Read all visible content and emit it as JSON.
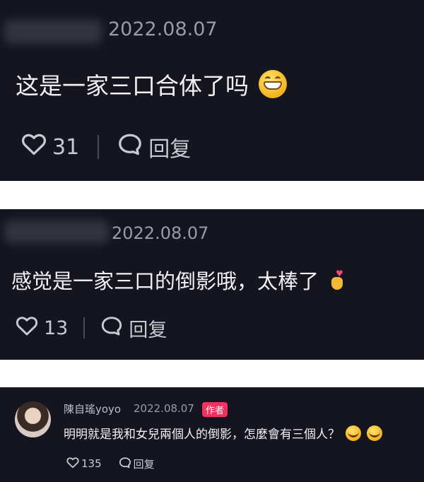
{
  "comments": [
    {
      "date": "2022.08.07",
      "text": "这是一家三口合体了吗",
      "emoji": "grinning-face-emoji",
      "likes": "31",
      "reply_label": "回复"
    },
    {
      "date": "2022.08.07",
      "text": "感觉是一家三口的倒影哦，太棒了",
      "emoji": "heart-hand-emoji",
      "likes": "13",
      "reply_label": "回复"
    },
    {
      "username": "陳自瑤yoyo",
      "date": "2022.08.07",
      "badge": "作者",
      "text": "明明就是我和女兒兩個人的倒影，怎麼會有三個人？",
      "emoji": "tears-of-joy-emoji",
      "likes": "135",
      "reply_label": "回复"
    }
  ],
  "colors": {
    "card_background": "#151520",
    "badge": "#f2335e",
    "secondary_text": "#9b9ba6"
  }
}
